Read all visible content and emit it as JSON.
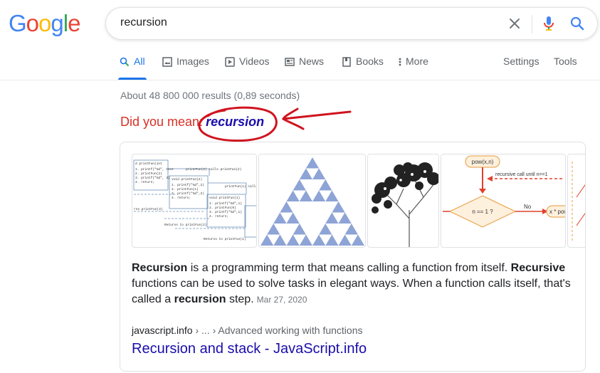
{
  "logo": {
    "letters": [
      "G",
      "o",
      "o",
      "g",
      "l",
      "e"
    ],
    "colors": [
      "#4285f4",
      "#ea4335",
      "#fbbc05",
      "#4285f4",
      "#34a853",
      "#ea4335"
    ]
  },
  "search": {
    "query": "recursion"
  },
  "tabs": [
    {
      "label": "All",
      "icon": "search-icon",
      "active": true
    },
    {
      "label": "Images",
      "icon": "image-icon"
    },
    {
      "label": "Videos",
      "icon": "video-icon"
    },
    {
      "label": "News",
      "icon": "news-icon"
    },
    {
      "label": "Books",
      "icon": "book-icon"
    },
    {
      "label": "More",
      "icon": "more-vert-icon"
    }
  ],
  "tools": {
    "settings": "Settings",
    "tools": "Tools"
  },
  "stats": "About 48 800 000 results (0,89 seconds)",
  "did_you_mean": {
    "prefix": "Did you mean:",
    "suggestion": "recursion"
  },
  "card": {
    "thumb_texts": {
      "flow_label_1": "pow(x,n)",
      "flow_label_2": "recursive call until n==1",
      "flow_label_3": "n == 1 ?",
      "flow_label_4": "No",
      "flow_label_5": "x * pow"
    },
    "snippet": {
      "b1": "Recursion",
      "t1": " is a programming term that means calling a function from itself. ",
      "b2": "Recursive",
      "t2": " functions can be used to solve tasks in elegant ways. When a function calls itself, that's called a ",
      "b3": "recursion",
      "t3": " step.",
      "date": "Mar 27, 2020"
    },
    "cite": {
      "domain": "javascript.info",
      "path": " › ... › Advanced working with functions"
    },
    "title": "Recursion and stack - JavaScript.info"
  },
  "colors": {
    "link": "#1a0dab",
    "accent": "#1a73e8",
    "alert": "#d93025",
    "annotation": "#d0141e"
  }
}
